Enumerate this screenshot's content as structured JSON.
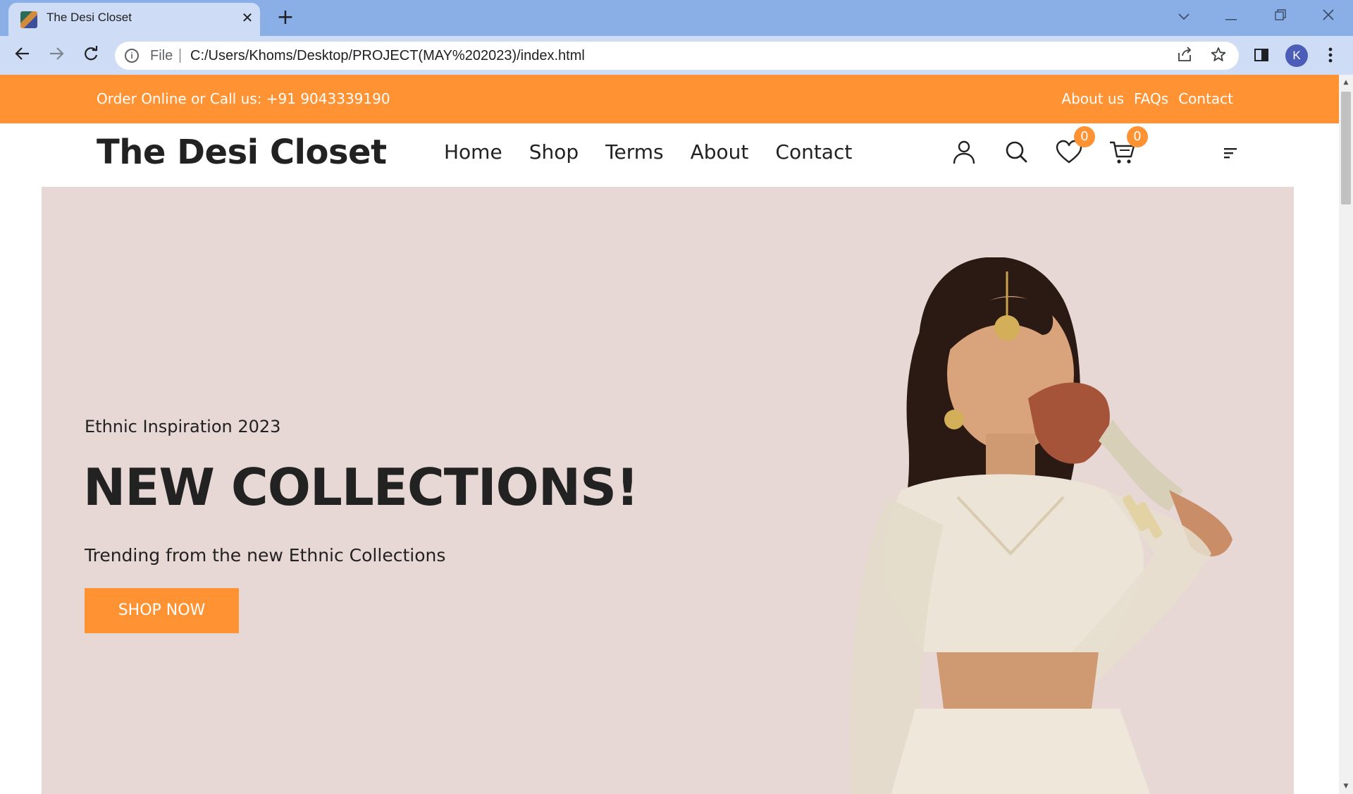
{
  "browser": {
    "tab_title": "The Desi Closet",
    "omnibox_scheme_label": "File",
    "url": "C:/Users/Khoms/Desktop/PROJECT(MAY%202023)/index.html",
    "profile_initial": "K"
  },
  "topbar": {
    "contact_text": "Order Online or Call us: +91 9043339190",
    "links": [
      "About us",
      "FAQs",
      "Contact"
    ]
  },
  "header": {
    "logo": "The Desi Closet",
    "nav": [
      "Home",
      "Shop",
      "Terms",
      "About",
      "Contact"
    ],
    "wishlist_count": "0",
    "cart_count": "0"
  },
  "hero": {
    "kicker": "Ethnic Inspiration 2023",
    "title": "NEW COLLECTIONS!",
    "subtitle": "Trending from the new Ethnic Collections",
    "cta_label": "SHOP NOW"
  },
  "colors": {
    "accent": "#ff9233",
    "hero_bg": "#e8d8d5",
    "text": "#222222"
  },
  "icons": [
    "user-icon",
    "search-icon",
    "heart-icon",
    "cart-icon",
    "menu-icon"
  ]
}
